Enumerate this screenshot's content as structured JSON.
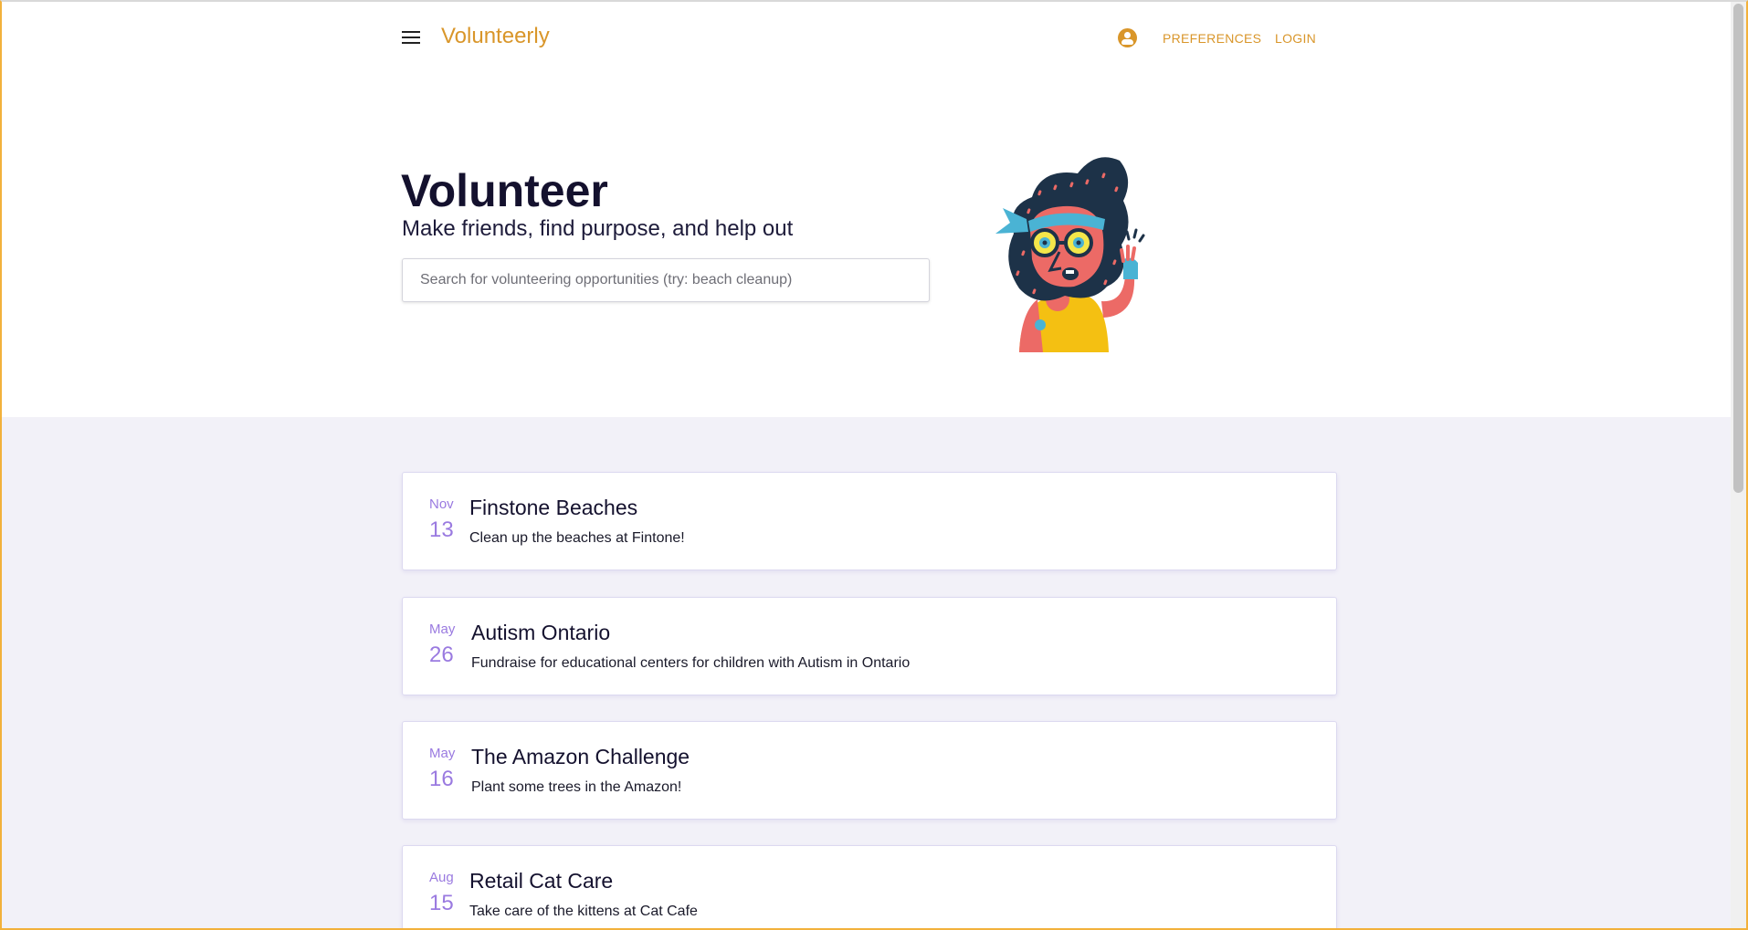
{
  "header": {
    "brand": "Volunteerly",
    "nav": {
      "preferences": "PREFERENCES",
      "login": "LOGIN"
    },
    "icons": {
      "menu": "menu-icon",
      "account": "account-circle-icon"
    }
  },
  "hero": {
    "title": "Volunteer",
    "subtitle": "Make friends, find purpose, and help out",
    "search_placeholder": "Search for volunteering opportunities (try: beach cleanup)",
    "search_value": ""
  },
  "opportunities": [
    {
      "month": "Nov",
      "day": "13",
      "title": "Finstone Beaches",
      "description": "Clean up the beaches at Fintone!"
    },
    {
      "month": "May",
      "day": "26",
      "title": "Autism Ontario",
      "description": "Fundraise for educational centers for children with Autism in Ontario"
    },
    {
      "month": "May",
      "day": "16",
      "title": "The Amazon Challenge",
      "description": "Plant some trees in the Amazon!"
    },
    {
      "month": "Aug",
      "day": "15",
      "title": "Retail Cat Care",
      "description": "Take care of the kittens at Cat Cafe"
    }
  ],
  "colors": {
    "brand": "#d9962a",
    "accent_date": "#9a7ae0",
    "feed_background": "#f2f1f8",
    "heading": "#14112e"
  }
}
